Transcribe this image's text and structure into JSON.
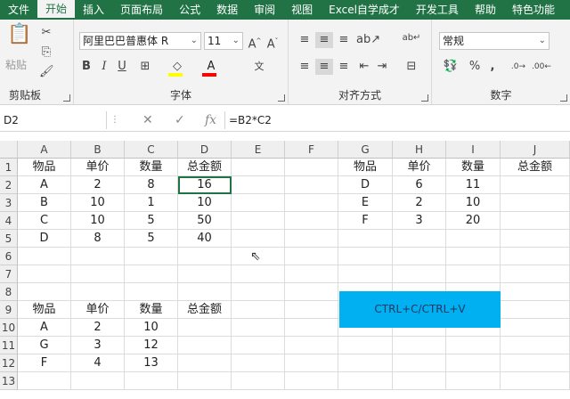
{
  "tabs": [
    "文件",
    "开始",
    "插入",
    "页面布局",
    "公式",
    "数据",
    "审阅",
    "视图",
    "Excel自学成才",
    "开发工具",
    "帮助",
    "特色功能"
  ],
  "ribbon": {
    "clipboard": {
      "label": "剪贴板",
      "paste": "粘贴"
    },
    "font": {
      "label": "字体",
      "name": "阿里巴巴普惠体 R",
      "size": "11",
      "bold": "B",
      "italic": "I",
      "underline": "U",
      "grow": "A^",
      "shrink": "A˅",
      "fill_color": "#FFFF00",
      "font_color": "#FF0000"
    },
    "align": {
      "label": "对齐方式"
    },
    "number": {
      "label": "数字",
      "format": "常规",
      "percent": "%",
      "comma": ","
    }
  },
  "formula_bar": {
    "name_box": "D2",
    "formula": "=B2*C2",
    "fx": "fx"
  },
  "columns": [
    "A",
    "B",
    "C",
    "D",
    "E",
    "F",
    "G",
    "H",
    "I",
    "J"
  ],
  "rows": [
    "1",
    "2",
    "3",
    "4",
    "5",
    "6",
    "7",
    "8",
    "9",
    "10",
    "11",
    "12",
    "13"
  ],
  "table1": {
    "headers": [
      "物品",
      "单价",
      "数量",
      "总金额"
    ],
    "rows": [
      [
        "A",
        "2",
        "8",
        "16"
      ],
      [
        "B",
        "10",
        "1",
        "10"
      ],
      [
        "C",
        "10",
        "5",
        "50"
      ],
      [
        "D",
        "8",
        "5",
        "40"
      ]
    ]
  },
  "table2": {
    "headers": [
      "物品",
      "单价",
      "数量",
      "总金额"
    ],
    "rows": [
      [
        "D",
        "6",
        "11",
        ""
      ],
      [
        "E",
        "2",
        "10",
        ""
      ],
      [
        "F",
        "3",
        "20",
        ""
      ]
    ]
  },
  "table3": {
    "headers": [
      "物品",
      "单价",
      "数量",
      "总金额"
    ],
    "rows": [
      [
        "A",
        "2",
        "10",
        ""
      ],
      [
        "G",
        "3",
        "12",
        ""
      ],
      [
        "F",
        "4",
        "13",
        ""
      ]
    ]
  },
  "note": "CTRL+C/CTRL+V",
  "colors": {
    "excel_green": "#217346",
    "note_bg": "#00b0f0"
  }
}
